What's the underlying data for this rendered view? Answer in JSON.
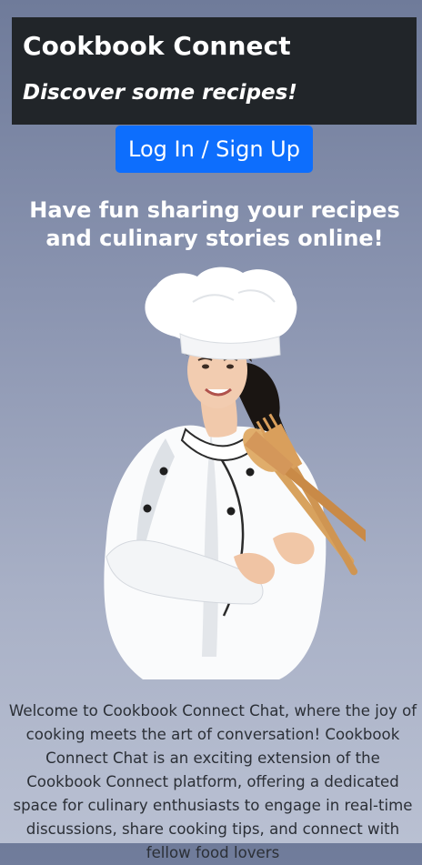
{
  "header": {
    "title": "Cookbook Connect",
    "subtitle": "Discover some recipes!"
  },
  "auth": {
    "login_label": "Log In / Sign Up"
  },
  "hero": {
    "tagline": "Have fun sharing your recipes and culinary stories online!",
    "image": {
      "icon": "chef-illustration"
    }
  },
  "intro": {
    "text": "Welcome to Cookbook Connect Chat, where the joy of cooking meets the art of conversation! Cookbook Connect Chat is an exciting extension of the Cookbook Connect platform, offering a dedicated space for culinary enthusiasts to engage in real-time discussions, share cooking tips, and connect with fellow food lovers"
  },
  "colors": {
    "header_bg": "#212529",
    "button_bg": "#0d6efd",
    "page_bg_top": "#6f7b9a",
    "page_bg_bottom": "#b9c0d2"
  }
}
